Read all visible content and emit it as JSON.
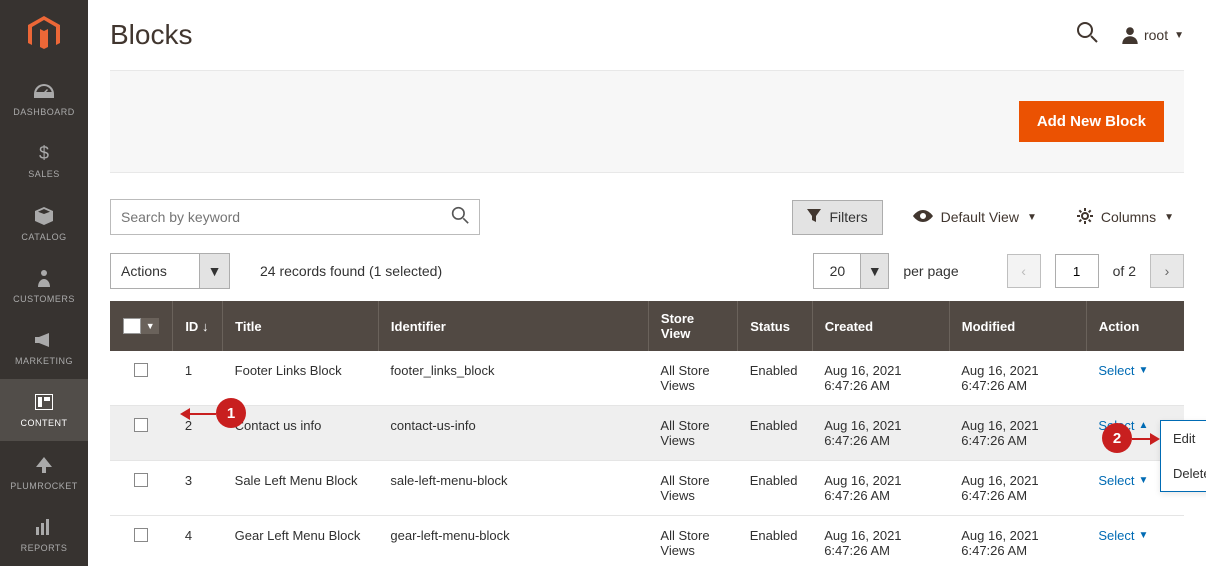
{
  "header": {
    "title": "Blocks",
    "user": "root"
  },
  "sidebar": {
    "items": [
      {
        "label": "DASHBOARD"
      },
      {
        "label": "SALES"
      },
      {
        "label": "CATALOG"
      },
      {
        "label": "CUSTOMERS"
      },
      {
        "label": "MARKETING"
      },
      {
        "label": "CONTENT"
      },
      {
        "label": "PLUMROCKET"
      },
      {
        "label": "REPORTS"
      }
    ]
  },
  "buttons": {
    "add_new": "Add New Block",
    "filters": "Filters",
    "default_view": "Default View",
    "columns": "Columns",
    "actions": "Actions"
  },
  "search": {
    "placeholder": "Search by keyword"
  },
  "summary": {
    "records_found": "24 records found (1 selected)"
  },
  "pager": {
    "page_size": "20",
    "per_page": "per page",
    "page": "1",
    "of": "of 2"
  },
  "columns": {
    "id": "ID",
    "title": "Title",
    "identifier": "Identifier",
    "store": "Store View",
    "status": "Status",
    "created": "Created",
    "modified": "Modified",
    "action": "Action"
  },
  "action_select": "Select",
  "action_menu": {
    "edit": "Edit",
    "delete": "Delete"
  },
  "rows": [
    {
      "id": "1",
      "title": "Footer Links Block",
      "identifier": "footer_links_block",
      "store": "All Store Views",
      "status": "Enabled",
      "created": "Aug 16, 2021 6:47:26 AM",
      "modified": "Aug 16, 2021 6:47:26 AM"
    },
    {
      "id": "2",
      "title": "Contact us info",
      "identifier": "contact-us-info",
      "store": "All Store Views",
      "status": "Enabled",
      "created": "Aug 16, 2021 6:47:26 AM",
      "modified": "Aug 16, 2021 6:47:26 AM"
    },
    {
      "id": "3",
      "title": "Sale Left Menu Block",
      "identifier": "sale-left-menu-block",
      "store": "All Store Views",
      "status": "Enabled",
      "created": "Aug 16, 2021 6:47:26 AM",
      "modified": "Aug 16, 2021 6:47:26 AM"
    },
    {
      "id": "4",
      "title": "Gear Left Menu Block",
      "identifier": "gear-left-menu-block",
      "store": "All Store Views",
      "status": "Enabled",
      "created": "Aug 16, 2021 6:47:26 AM",
      "modified": "Aug 16, 2021 6:47:26 AM"
    }
  ],
  "annotations": {
    "a1": "1",
    "a2": "2"
  }
}
